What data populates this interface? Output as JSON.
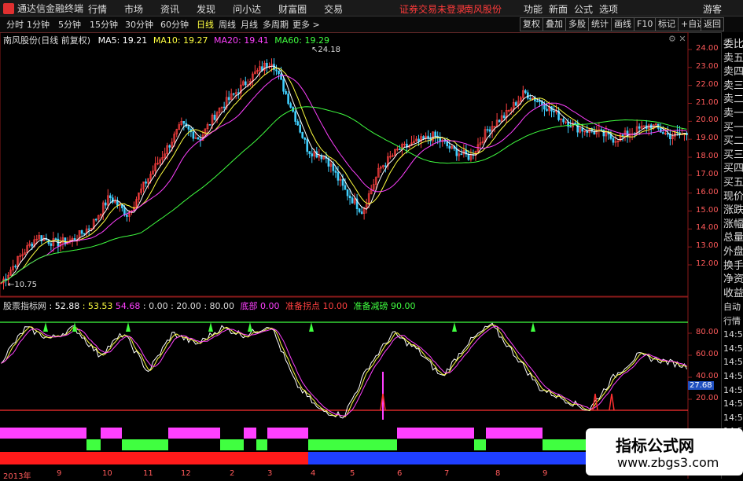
{
  "titlebar": {
    "app_name": "通达信金融终端",
    "menu": [
      "行情",
      "市场",
      "资讯",
      "发现",
      "问小达",
      "财富圈",
      "交易"
    ],
    "notice": "证券交易未登录",
    "stock": "南风股份",
    "right": [
      "功能",
      "新面",
      "公式",
      "选项"
    ],
    "user": "游客"
  },
  "toolbar": {
    "periods": [
      "分时",
      "1分钟",
      "5分钟",
      "15分钟",
      "30分钟",
      "60分钟",
      "日线",
      "周线",
      "月线",
      "多周期",
      "更多 >"
    ],
    "active": "日线",
    "buttons": [
      "复权",
      "叠加",
      "多股",
      "统计",
      "画线",
      "F10",
      "标记",
      "+自选",
      "返回"
    ]
  },
  "main_legend": {
    "title": "南风股份(日线 前复权)",
    "ma5": "MA5: 19.21",
    "ma10": "MA10: 19.27",
    "ma20": "MA20: 19.41",
    "ma60": "MA60: 19.29",
    "high_label": "24.18",
    "low_label": "10.75",
    "colors": {
      "ma5": "#ffffff",
      "ma10": "#ffff40",
      "ma20": "#ff40ff",
      "ma60": "#40ff40"
    }
  },
  "price_axis": [
    "24.00",
    "23.00",
    "22.00",
    "21.00",
    "20.00",
    "19.00",
    "18.00",
    "17.00",
    "16.00",
    "15.00",
    "14.00",
    "13.00",
    "12.00"
  ],
  "indicator_legend": {
    "title": "股票指标网",
    "v1": ": 52.88",
    "v2": ": 53.53",
    "v3": "54.68",
    "v4": ": 0.00",
    "v5": ": 20.00",
    "v6": ": 80.00",
    "l1": "底部",
    "l1v": "0.00",
    "l2": "准备拐点",
    "l2v": "10.00",
    "l3": "准备减磅",
    "l3v": "90.00"
  },
  "indicator_axis": [
    "80.00",
    "60.00",
    "40.00",
    "20.00"
  ],
  "indicator_current": "27.68",
  "x_axis": [
    "2013年",
    "9",
    "10",
    "11",
    "12",
    "2",
    "3",
    "4",
    "5",
    "6",
    "7",
    "8",
    "9"
  ],
  "right_panel": [
    "委比",
    "卖五",
    "卖四",
    "卖三",
    "卖二",
    "卖一",
    "买一",
    "买二",
    "买三",
    "买四",
    "买五",
    "现价",
    "涨跌",
    "涨幅",
    "总量",
    "外盘",
    "换手",
    "净资",
    "收益"
  ],
  "right_panel2": [
    "自动",
    "行情",
    "14:5",
    "14:5",
    "14:5",
    "14:5",
    "14:5",
    "14:5",
    "14:5",
    "14:5"
  ],
  "watermark": {
    "t1": "指标公式网",
    "t2": "www.zbgs3.com"
  }
}
